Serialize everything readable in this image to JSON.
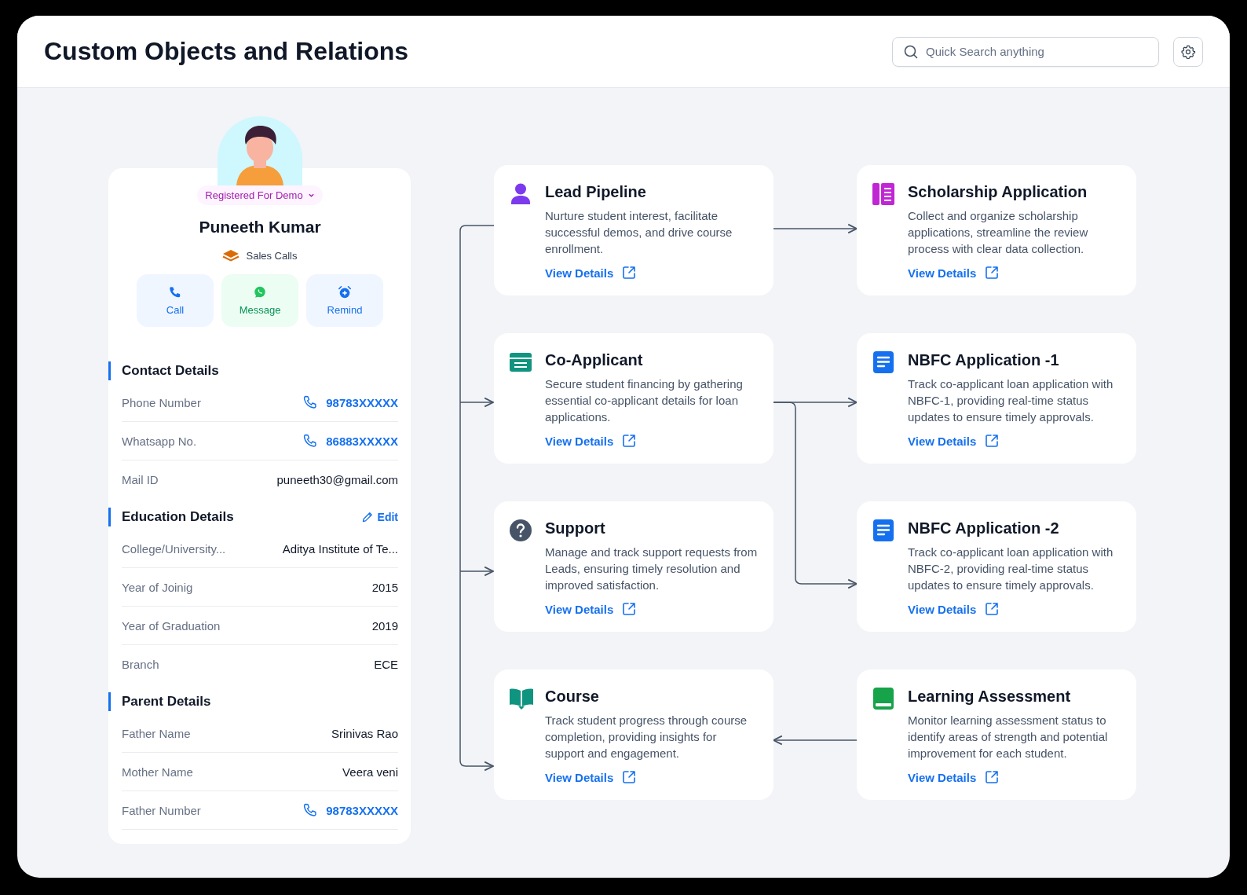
{
  "header": {
    "title": "Custom Objects and Relations",
    "search": {
      "placeholder": "Quick Search anything"
    }
  },
  "profile": {
    "status": "Registered For Demo",
    "name": "Puneeth Kumar",
    "pipeline": "Sales Calls",
    "actions": [
      {
        "kind": "call",
        "label": "Call"
      },
      {
        "kind": "message",
        "label": "Message"
      },
      {
        "kind": "remind",
        "label": "Remind"
      }
    ],
    "sections": [
      {
        "title": "Contact Details",
        "rows": [
          {
            "label": "Phone Number",
            "value": "98783XXXXX",
            "kind": "phone"
          },
          {
            "label": "Whatsapp No.",
            "value": "86883XXXXX",
            "kind": "phone"
          },
          {
            "label": "Mail ID",
            "value": "puneeth30@gmail.com",
            "kind": "text"
          }
        ]
      },
      {
        "title": "Education Details",
        "action": "Edit",
        "rows": [
          {
            "label": "College/University...",
            "value": "Aditya Institute of Te...",
            "kind": "text"
          },
          {
            "label": "Year of Joinig",
            "value": "2015",
            "kind": "text"
          },
          {
            "label": "Year of Graduation",
            "value": "2019",
            "kind": "text"
          },
          {
            "label": "Branch",
            "value": "ECE",
            "kind": "text"
          }
        ]
      },
      {
        "title": "Parent Details",
        "rows": [
          {
            "label": "Father Name",
            "value": "Srinivas Rao",
            "kind": "text"
          },
          {
            "label": "Mother Name",
            "value": "Veera veni",
            "kind": "text"
          },
          {
            "label": "Father Number",
            "value": "98783XXXXX",
            "kind": "phone"
          }
        ]
      }
    ]
  },
  "objects": [
    {
      "title": "Lead Pipeline",
      "description": "Nurture student interest, facilitate successful demos, and drive course enrollment.",
      "link": "View Details",
      "kind": "person",
      "color": "#7c3aed"
    },
    {
      "title": "Scholarship Application",
      "description": "Collect and organize scholarship applications, streamline the review process with clear data collection.",
      "link": "View Details",
      "kind": "form",
      "color": "#c026d3"
    },
    {
      "title": "Co-Applicant",
      "description": "Secure student financing by gathering essential co-applicant details for loan applications.",
      "link": "View Details",
      "kind": "list",
      "color": "#0f9480"
    },
    {
      "title": "NBFC Application -1",
      "description": "Track co-applicant loan application with NBFC-1, providing real-time status updates to ensure timely approvals.",
      "link": "View Details",
      "kind": "document",
      "color": "#1570ef"
    },
    {
      "title": "Support",
      "description": "Manage and track support requests from Leads, ensuring timely resolution and improved satisfaction.",
      "link": "View Details",
      "kind": "question",
      "color": "#475467"
    },
    {
      "title": "NBFC Application -2",
      "description": "Track co-applicant loan application with NBFC-2, providing real-time status updates to ensure timely approvals.",
      "link": "View Details",
      "kind": "document",
      "color": "#1570ef"
    },
    {
      "title": "Course",
      "description": "Track student progress through course completion, providing insights for support and engagement.",
      "link": "View Details",
      "kind": "book",
      "color": "#0f9480"
    },
    {
      "title": "Learning Assessment",
      "description": "Monitor learning assessment status to identify areas of strength and potential improvement for each student.",
      "link": "View Details",
      "kind": "notebook",
      "color": "#16a34a"
    }
  ]
}
